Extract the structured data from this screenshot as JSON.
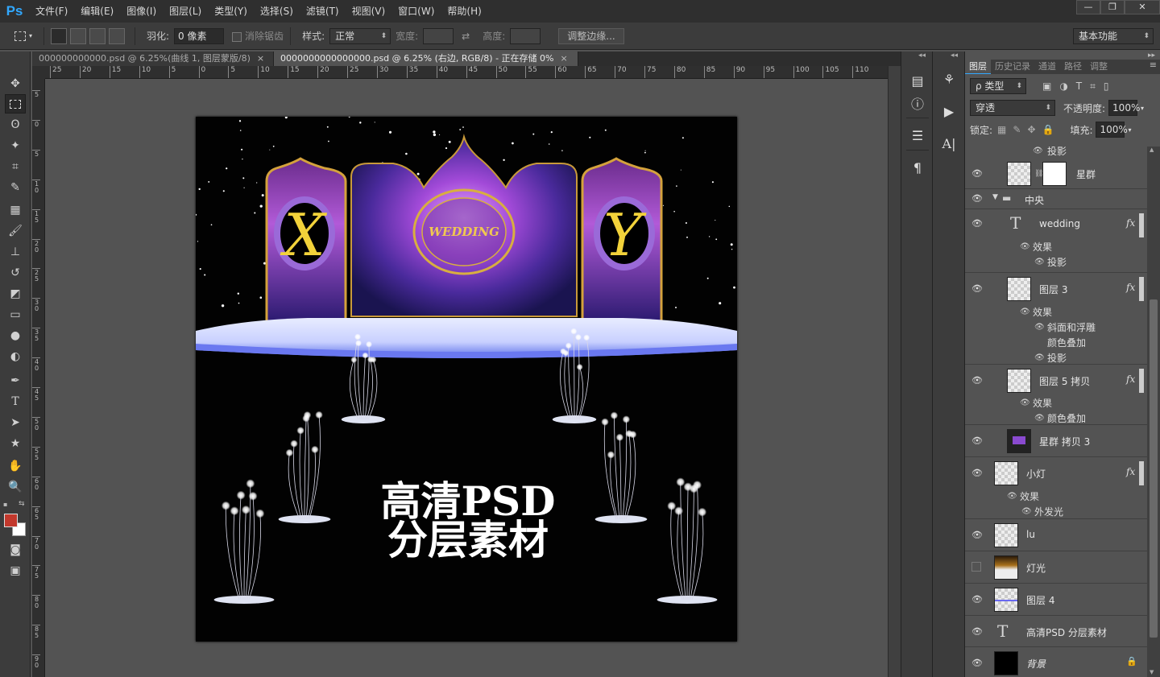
{
  "app": {
    "logo": "Ps"
  },
  "menu": [
    "文件(F)",
    "编辑(E)",
    "图像(I)",
    "图层(L)",
    "类型(Y)",
    "选择(S)",
    "滤镜(T)",
    "视图(V)",
    "窗口(W)",
    "帮助(H)"
  ],
  "window_controls": {
    "minimize": "—",
    "restore": "❐",
    "close": "✕"
  },
  "options": {
    "feather_label": "羽化:",
    "feather_value": "0 像素",
    "antialias_label": "消除锯齿",
    "style_label": "样式:",
    "style_value": "正常",
    "width_label": "宽度:",
    "height_label": "高度:",
    "refine_edge": "调整边缘...",
    "workspace": "基本功能"
  },
  "tabs": [
    {
      "label": "000000000000.psd @ 6.25%(曲线 1, 图层蒙版/8)",
      "close": "×",
      "active": false
    },
    {
      "label": "0000000000000000.psd @ 6.25% (右边, RGB/8) - 正在存储 0%",
      "close": "×",
      "active": true
    }
  ],
  "ruler_h": [
    "25",
    "20",
    "15",
    "10",
    "5",
    "0",
    "5",
    "10",
    "15",
    "20",
    "25",
    "30",
    "35",
    "40",
    "45",
    "50",
    "55",
    "60",
    "65",
    "70",
    "75",
    "80",
    "85",
    "90",
    "95",
    "100",
    "105",
    "110"
  ],
  "ruler_v": [
    "5",
    "0",
    "5",
    "10",
    "15",
    "20",
    "25",
    "30",
    "35",
    "40",
    "45",
    "50",
    "55",
    "60",
    "65",
    "70",
    "75",
    "80",
    "85",
    "90"
  ],
  "canvas": {
    "title_line1": "高清PSD",
    "title_line2": "分层素材",
    "emblem_text": "WEDDING",
    "left_initial": "X",
    "right_initial": "Y"
  },
  "tools": [
    "move-icon",
    "marquee-icon",
    "lasso-icon",
    "magic-wand-icon",
    "crop-icon",
    "eyedropper-icon",
    "healing-icon",
    "brush-icon",
    "stamp-icon",
    "history-brush-icon",
    "eraser-icon",
    "gradient-icon",
    "blur-icon",
    "dodge-icon",
    "pen-icon",
    "type-icon",
    "path-select-icon",
    "shape-icon",
    "hand-icon",
    "zoom-icon"
  ],
  "colors": {
    "foreground": "#c2382c",
    "background": "#ffffff",
    "accent": "#31a8ff"
  },
  "panel_tabs": [
    "图层",
    "历史记录",
    "通道",
    "路径",
    "调整"
  ],
  "layers_panel": {
    "filter_kind": "ρ 类型",
    "blend_mode": "穿透",
    "opacity_label": "不透明度:",
    "opacity_value": "100%",
    "lock_label": "锁定:",
    "fill_label": "填充:",
    "fill_value": "100%"
  },
  "layers": [
    {
      "name": "星群",
      "top_effect": "投影"
    },
    {
      "name": "中央"
    },
    {
      "name": "wedding",
      "fx": "fx",
      "effects_label": "效果",
      "effects": [
        "投影"
      ]
    },
    {
      "name": "图层 3",
      "fx": "fx",
      "effects_label": "效果",
      "effects": [
        "斜面和浮雕",
        "颜色叠加",
        "投影"
      ]
    },
    {
      "name": "图层 5 拷贝",
      "fx": "fx",
      "effects_label": "效果",
      "effects": [
        "颜色叠加"
      ]
    },
    {
      "name": "星群 拷贝 3"
    },
    {
      "name": "小灯",
      "fx": "fx",
      "effects_label": "效果",
      "effects": [
        "外发光"
      ]
    },
    {
      "name": "lu"
    },
    {
      "name": "灯光"
    },
    {
      "name": "图层 4"
    },
    {
      "name": "高清PSD 分层素材"
    },
    {
      "name": "背景"
    }
  ]
}
